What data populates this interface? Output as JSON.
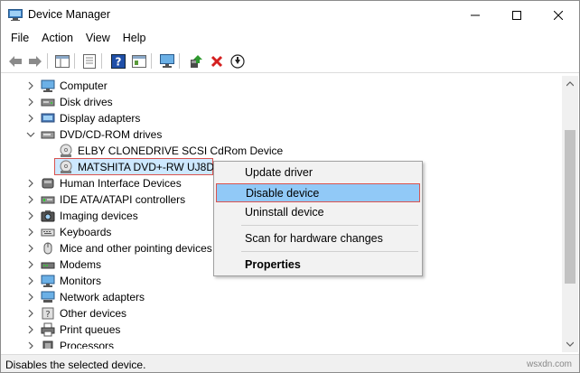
{
  "window": {
    "title": "Device Manager"
  },
  "menubar": {
    "items": [
      "File",
      "Action",
      "View",
      "Help"
    ]
  },
  "toolbar": {
    "buttons": [
      "back-arrow-icon",
      "forward-arrow-icon",
      "show-hide-tree-icon",
      "properties-icon",
      "help-icon",
      "action-view-icon",
      "monitor-icon",
      "update-driver-icon",
      "uninstall-red-x-icon",
      "disable-down-arrow-icon"
    ]
  },
  "tree": {
    "items": [
      {
        "label": "Computer",
        "expanded": false,
        "indent": 0,
        "icon": "computer-icon"
      },
      {
        "label": "Disk drives",
        "expanded": false,
        "indent": 0,
        "icon": "disk-drive-icon"
      },
      {
        "label": "Display adapters",
        "expanded": false,
        "indent": 0,
        "icon": "display-adapter-icon"
      },
      {
        "label": "DVD/CD-ROM drives",
        "expanded": true,
        "indent": 0,
        "icon": "dvd-drive-icon"
      },
      {
        "label": "ELBY CLONEDRIVE SCSI CdRom Device",
        "expanded": null,
        "indent": 1,
        "icon": "cdrom-device-icon"
      },
      {
        "label": "MATSHITA DVD+-RW UJ8D1",
        "expanded": null,
        "indent": 1,
        "icon": "cdrom-device-icon",
        "selected": true
      },
      {
        "label": "Human Interface Devices",
        "expanded": false,
        "indent": 0,
        "icon": "hid-icon"
      },
      {
        "label": "IDE ATA/ATAPI controllers",
        "expanded": false,
        "indent": 0,
        "icon": "ide-controller-icon"
      },
      {
        "label": "Imaging devices",
        "expanded": false,
        "indent": 0,
        "icon": "camera-icon"
      },
      {
        "label": "Keyboards",
        "expanded": false,
        "indent": 0,
        "icon": "keyboard-icon"
      },
      {
        "label": "Mice and other pointing devices",
        "expanded": false,
        "indent": 0,
        "icon": "mouse-icon"
      },
      {
        "label": "Modems",
        "expanded": false,
        "indent": 0,
        "icon": "modem-icon"
      },
      {
        "label": "Monitors",
        "expanded": false,
        "indent": 0,
        "icon": "monitor-icon"
      },
      {
        "label": "Network adapters",
        "expanded": false,
        "indent": 0,
        "icon": "network-adapter-icon"
      },
      {
        "label": "Other devices",
        "expanded": false,
        "indent": 0,
        "icon": "other-devices-icon"
      },
      {
        "label": "Print queues",
        "expanded": false,
        "indent": 0,
        "icon": "printer-icon"
      },
      {
        "label": "Processors",
        "expanded": false,
        "indent": 0,
        "icon": "processor-icon"
      }
    ]
  },
  "context_menu": {
    "items": [
      {
        "label": "Update driver"
      },
      {
        "label": "Disable device",
        "active": true
      },
      {
        "label": "Uninstall device"
      },
      {
        "label": "Scan for hardware changes"
      },
      {
        "label": "Properties",
        "bold": true
      }
    ]
  },
  "statusbar": {
    "text": "Disables the selected device.",
    "watermark": "wsxdn.com"
  },
  "colors": {
    "selection_bg": "#cde8ff",
    "menu_highlight": "#91c9f7",
    "highlight_border": "#d9534f",
    "uninstall_red": "#d42020"
  }
}
